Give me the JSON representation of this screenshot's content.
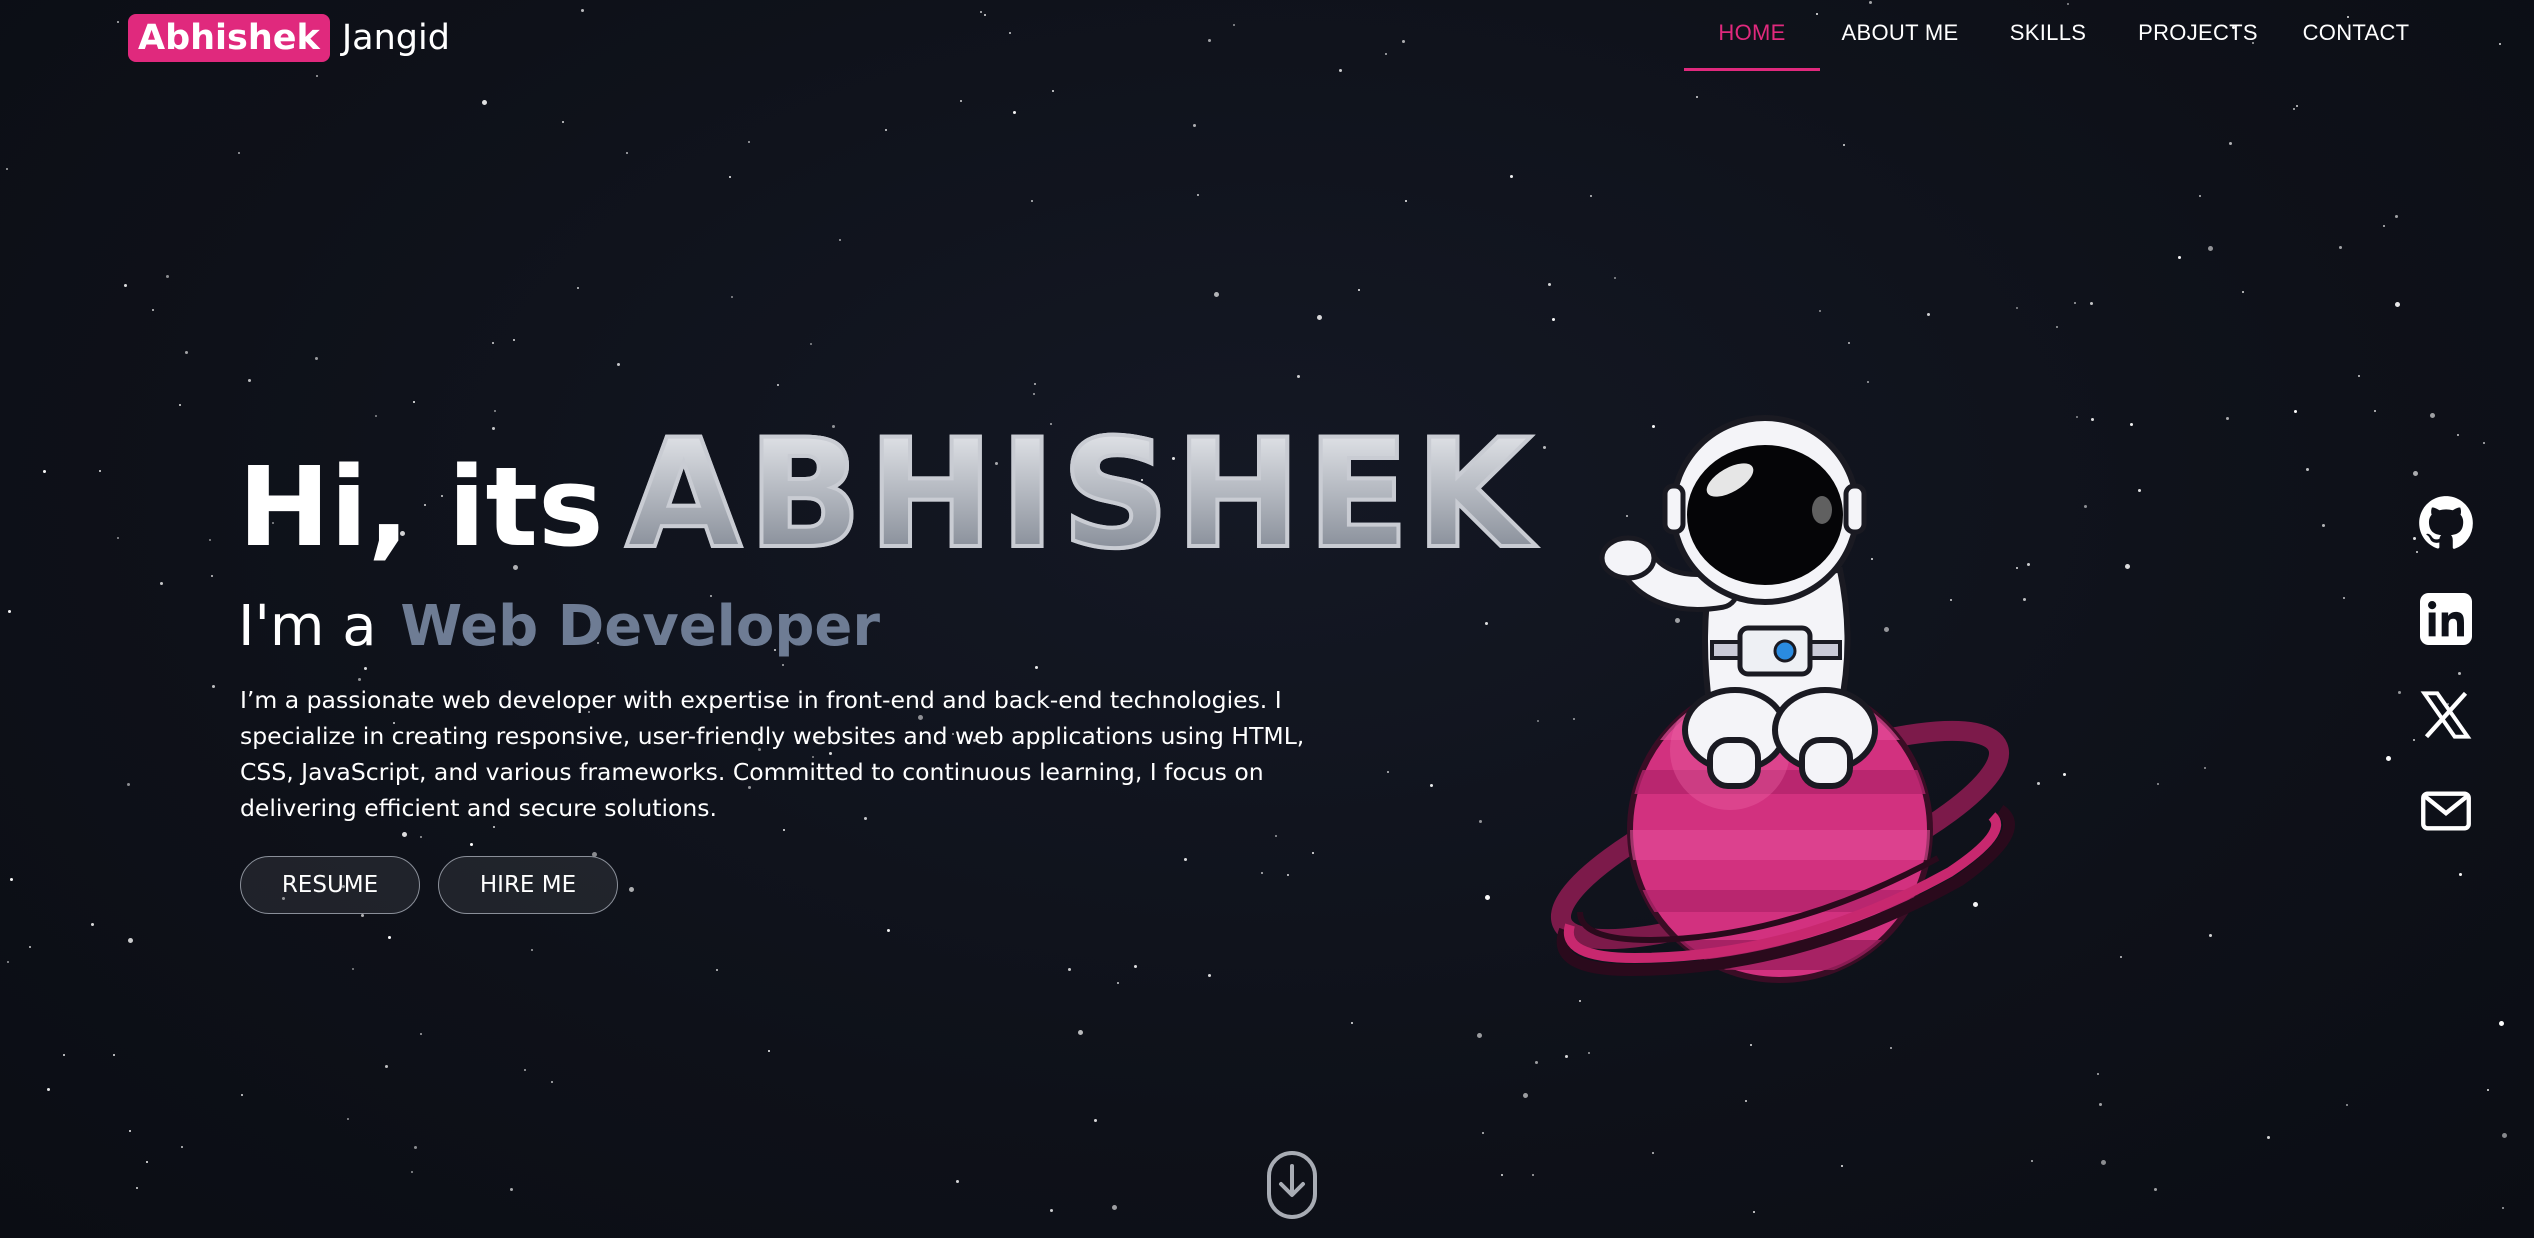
{
  "header": {
    "logo_badge": "Abhishek",
    "logo_rest": "Jangid"
  },
  "nav": {
    "items": [
      {
        "label": "HOME",
        "active": true
      },
      {
        "label": "ABOUT ME",
        "active": false
      },
      {
        "label": "SKILLS",
        "active": false
      },
      {
        "label": "PROJECTS",
        "active": false
      },
      {
        "label": "CONTACT",
        "active": false
      }
    ]
  },
  "hero": {
    "greeting": "Hi, its",
    "name": "ABHISHEK",
    "role_prefix": "I'm a",
    "role": "Web Developer",
    "description": "I’m a passionate web developer with expertise in front-end and back-end technologies. I specialize in creating responsive, user-friendly websites and web applications using HTML, CSS, JavaScript, and various frameworks. Committed to continuous learning, I focus on delivering efficient and secure solutions.",
    "buttons": {
      "resume": "RESUME",
      "hire": "HIRE ME"
    }
  },
  "socials": [
    {
      "icon": "github-icon"
    },
    {
      "icon": "linkedin-icon"
    },
    {
      "icon": "x-icon"
    },
    {
      "icon": "mail-icon"
    }
  ],
  "colors": {
    "accent": "#e0297d",
    "background": "#0e1119",
    "role_text": "#6e7c94"
  }
}
